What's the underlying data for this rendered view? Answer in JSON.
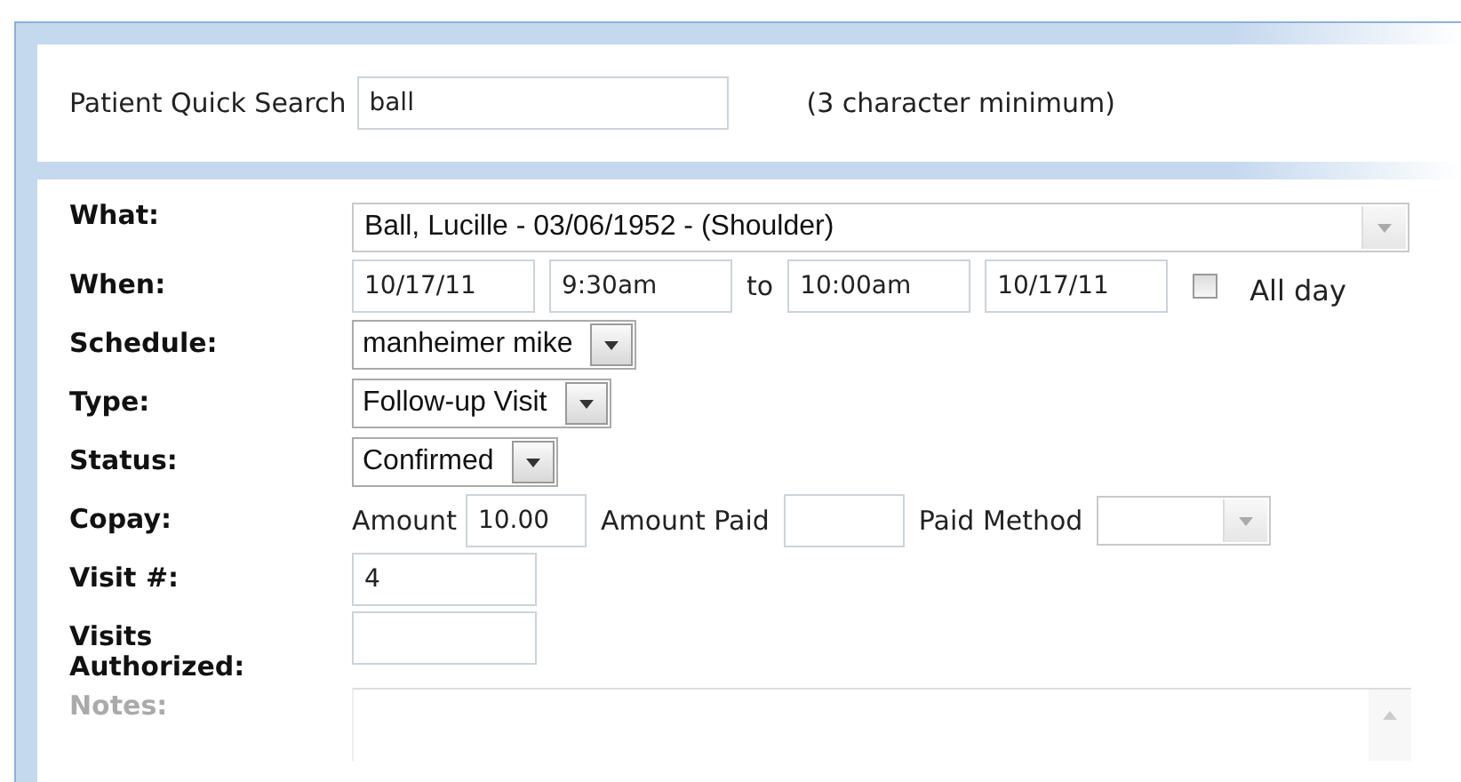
{
  "search": {
    "label": "Patient Quick Search",
    "value": "ball",
    "hint": "(3 character minimum)"
  },
  "rows": [
    {
      "kind": "combo",
      "label": "What:",
      "value": "Ball, Lucille - 03/06/1952 - (Shoulder)"
    },
    {
      "kind": "when",
      "label": "When:",
      "start_date": "10/17/11",
      "start_time": "9:30am",
      "separator": "to",
      "end_time": "10:00am",
      "end_date": "10/17/11",
      "all_day": {
        "label": "All day",
        "checked": false
      }
    },
    {
      "kind": "select",
      "label": "Schedule:",
      "value": "manheimer mike"
    },
    {
      "kind": "select",
      "label": "Type:",
      "value": "Follow-up Visit"
    },
    {
      "kind": "select",
      "label": "Status:",
      "value": "Confirmed"
    },
    {
      "kind": "copay",
      "label": "Copay:",
      "amount_label": "Amount",
      "amount": "10.00",
      "paid_label": "Amount Paid",
      "method_label": "Paid Method"
    },
    {
      "kind": "text",
      "label": "Visit #:",
      "value": "4"
    },
    {
      "kind": "text",
      "label": "Visits Authorized:"
    },
    {
      "kind": "notes",
      "label": "Notes:",
      "disabled": true
    }
  ]
}
